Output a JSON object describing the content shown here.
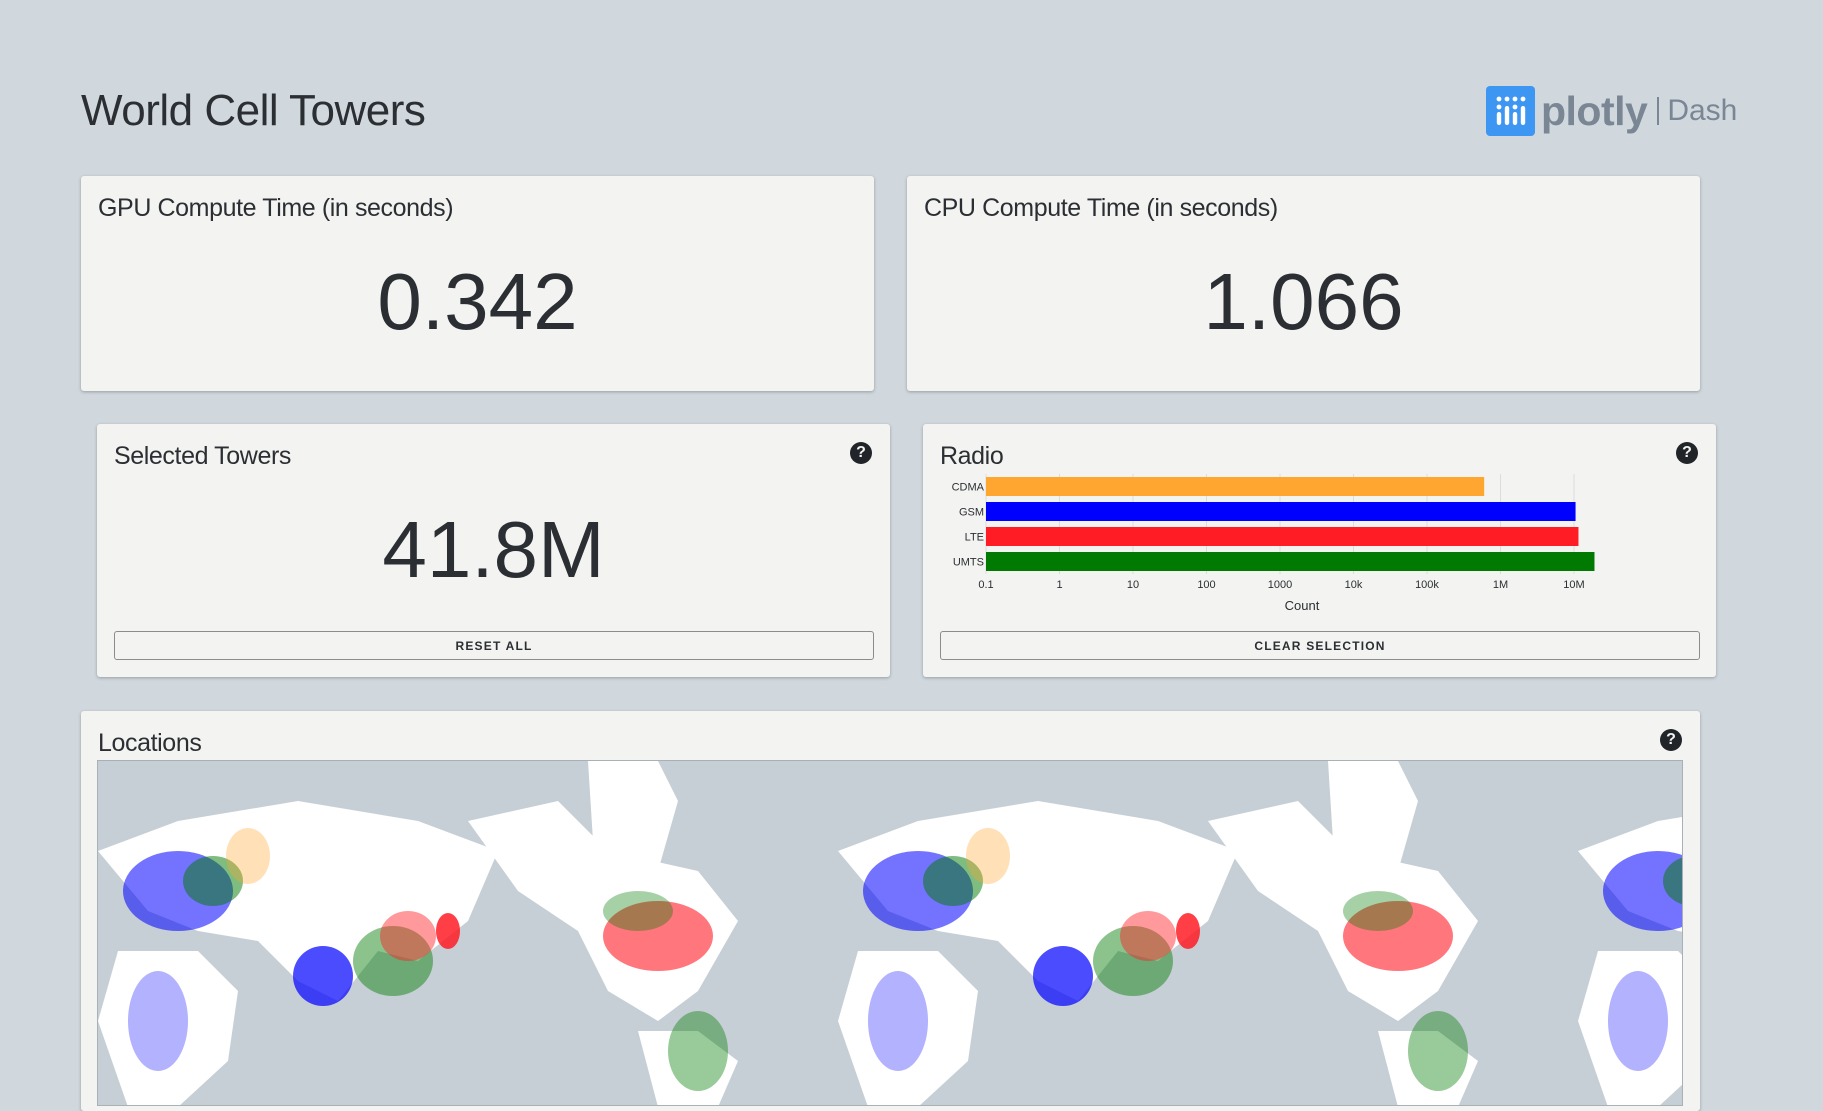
{
  "header": {
    "title": "World Cell Towers",
    "logo_word": "plotly",
    "logo_product": "Dash"
  },
  "gpu_card": {
    "title": "GPU Compute Time (in seconds)",
    "value": "0.342"
  },
  "cpu_card": {
    "title": "CPU Compute Time (in seconds)",
    "value": "1.066"
  },
  "selected_card": {
    "title": "Selected Towers",
    "value": "41.8M",
    "reset_label": "RESET ALL",
    "help_icon": "?"
  },
  "radio_card": {
    "title": "Radio",
    "clear_label": "CLEAR SELECTION",
    "help_icon": "?"
  },
  "locations_card": {
    "title": "Locations",
    "help_icon": "?"
  },
  "colors": {
    "background": "#d0d8de",
    "card": "#f3f3f1",
    "CDMA": "#ffa630",
    "GSM": "#0000ff",
    "LTE": "#ff1c24",
    "UMTS": "#007a00",
    "logo": "#3d96f2",
    "ocean": "#c6cfd5",
    "land": "#ffffff"
  },
  "chart_data": {
    "type": "bar",
    "orientation": "horizontal",
    "categories": [
      "CDMA",
      "GSM",
      "LTE",
      "UMTS"
    ],
    "values": [
      600000,
      10500000,
      11500000,
      19000000
    ],
    "xlabel": "Count",
    "ylabel": "",
    "xscale": "log",
    "xlim": [
      0.1,
      30000000
    ],
    "xticks": [
      0.1,
      1,
      10,
      100,
      1000,
      10000,
      100000,
      1000000,
      10000000
    ],
    "xtick_labels": [
      "0.1",
      "1",
      "10",
      "100",
      "1000",
      "10k",
      "100k",
      "1M",
      "10M"
    ],
    "grid": true
  }
}
